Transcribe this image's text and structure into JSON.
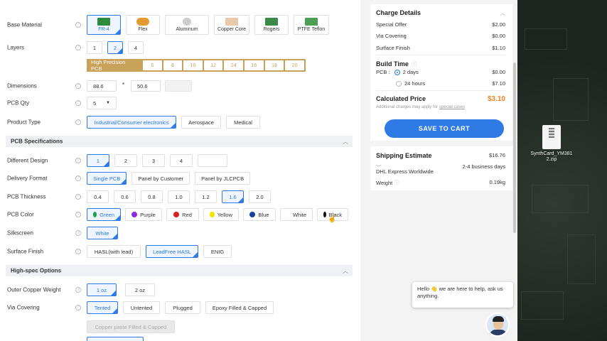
{
  "base_material": {
    "label": "Base Material",
    "options": [
      "FR-4",
      "Flex",
      "Aluminum",
      "Copper Core",
      "Rogers",
      "PTFE Teflon"
    ]
  },
  "layers": {
    "label": "Layers",
    "options": [
      "1",
      "2",
      "4"
    ],
    "high_precision_label": "High Precision PCB",
    "high_precision_options": [
      "6",
      "8",
      "10",
      "12",
      "14",
      "16",
      "18",
      "20"
    ]
  },
  "dimensions": {
    "label": "Dimensions",
    "width": "88.6",
    "separator": "*",
    "height": "50.6"
  },
  "pcb_qty": {
    "label": "PCB Qty",
    "value": "5"
  },
  "product_type": {
    "label": "Product Type",
    "options": [
      "Industrial/Consumer electronics",
      "Aerospace",
      "Medical"
    ]
  },
  "sections": {
    "pcb_specs": "PCB Specifications",
    "high_spec": "High-spec Options"
  },
  "different_design": {
    "label": "Different Design",
    "options": [
      "1",
      "2",
      "3",
      "4"
    ]
  },
  "delivery_format": {
    "label": "Delivery Format",
    "options": [
      "Single PCB",
      "Panel by Customer",
      "Panel by JLCPCB"
    ]
  },
  "pcb_thickness": {
    "label": "PCB Thickness",
    "options": [
      "0.4",
      "0.6",
      "0.8",
      "1.0",
      "1.2",
      "1.6",
      "2.0"
    ]
  },
  "pcb_color": {
    "label": "PCB Color",
    "options": [
      {
        "name": "Green",
        "color": "#22a04b"
      },
      {
        "name": "Purple",
        "color": "#8a2be2"
      },
      {
        "name": "Red",
        "color": "#d81e1e"
      },
      {
        "name": "Yellow",
        "color": "#f2e400"
      },
      {
        "name": "Blue",
        "color": "#1a3f9c"
      },
      {
        "name": "White",
        "color": "#ffffff"
      },
      {
        "name": "Black",
        "color": "#111111"
      }
    ]
  },
  "silkscreen": {
    "label": "Silkscreen",
    "value": "White"
  },
  "surface_finish": {
    "label": "Surface Finish",
    "options": [
      "HASL(with lead)",
      "LeadFree HASL",
      "ENIG"
    ]
  },
  "outer_copper": {
    "label": "Outer Copper Weight",
    "options": [
      "1 oz",
      "2 oz"
    ]
  },
  "via_covering": {
    "label": "Via Covering",
    "options": [
      "Tented",
      "Untented",
      "Plugged",
      "Epoxy Filled & Capped"
    ],
    "disabled_option": "Copper paste Filled & Capped"
  },
  "charge": {
    "title": "Charge Details",
    "items": [
      {
        "name": "Special Offer",
        "price": "$2.00"
      },
      {
        "name": "Via Covering",
        "price": "$0.00"
      },
      {
        "name": "Surface Finish",
        "price": "$1.10"
      }
    ],
    "build_time_title": "Build Time",
    "build_label": "PCB :",
    "build_options": [
      {
        "name": "2 days",
        "price": "$0.00"
      },
      {
        "name": "24 hours",
        "price": "$7.10"
      }
    ],
    "calculated_label": "Calculated Price",
    "calculated_value": "$3.10",
    "note": "Additional charges may apply for",
    "note_link": "special cases",
    "save_label": "SAVE TO CART"
  },
  "shipping": {
    "title": "Shipping Estimate",
    "price": "$16.76",
    "time": "2-4 business days",
    "carrier": "DHL Express Worldwide",
    "weight_label": "Weight",
    "weight_value": "0.19kg"
  },
  "chat": {
    "text": "Hello 👋 we are here to help, ask us anything."
  },
  "desktop_file": {
    "name": "SynthCard_YM381 2.zip"
  },
  "colors": {
    "accent": "#2f7ae5",
    "price": "#f58220",
    "gold": "#c9a25a"
  }
}
